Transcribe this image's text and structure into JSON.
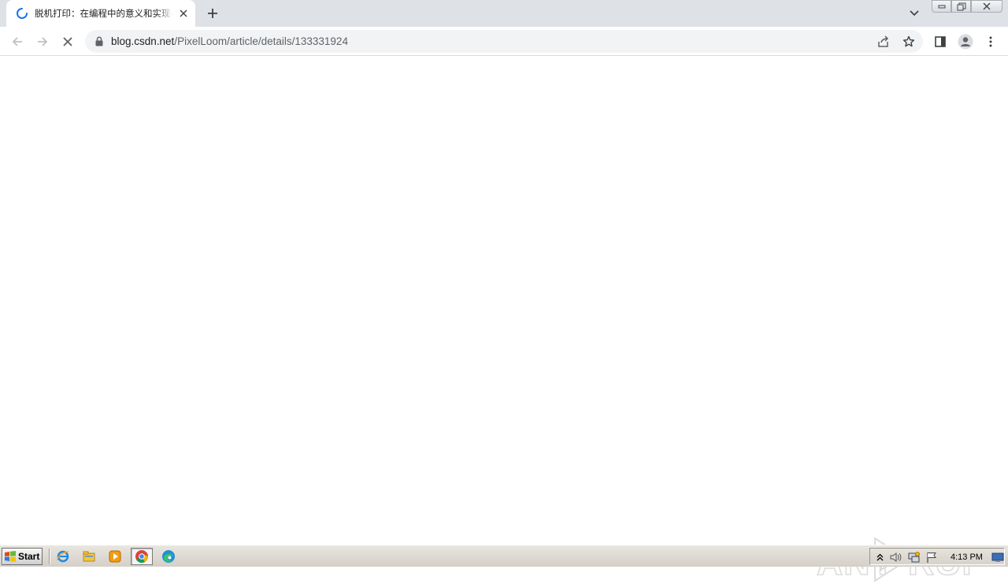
{
  "browser": {
    "tab": {
      "title": "脱机打印：在编程中的意义和实现-CSDN博客",
      "loading": true
    },
    "address_bar": {
      "host": "blog.csdn.net",
      "path": "/PixelLoom/article/details/133331924"
    }
  },
  "watermark": {
    "text": "ANY RUN"
  },
  "taskbar": {
    "start_label": "Start",
    "pinned": [
      "internet-explorer-icon",
      "file-explorer-icon",
      "media-player-icon",
      "chrome-icon",
      "edge-icon"
    ],
    "active_app": "chrome-icon",
    "clock": "4:13 PM"
  },
  "colors": {
    "tab_strip": "#dee1e6",
    "omnibox": "#f1f3f4",
    "spinner": "#1a73e8",
    "taskbar": "#d4d0c8"
  }
}
